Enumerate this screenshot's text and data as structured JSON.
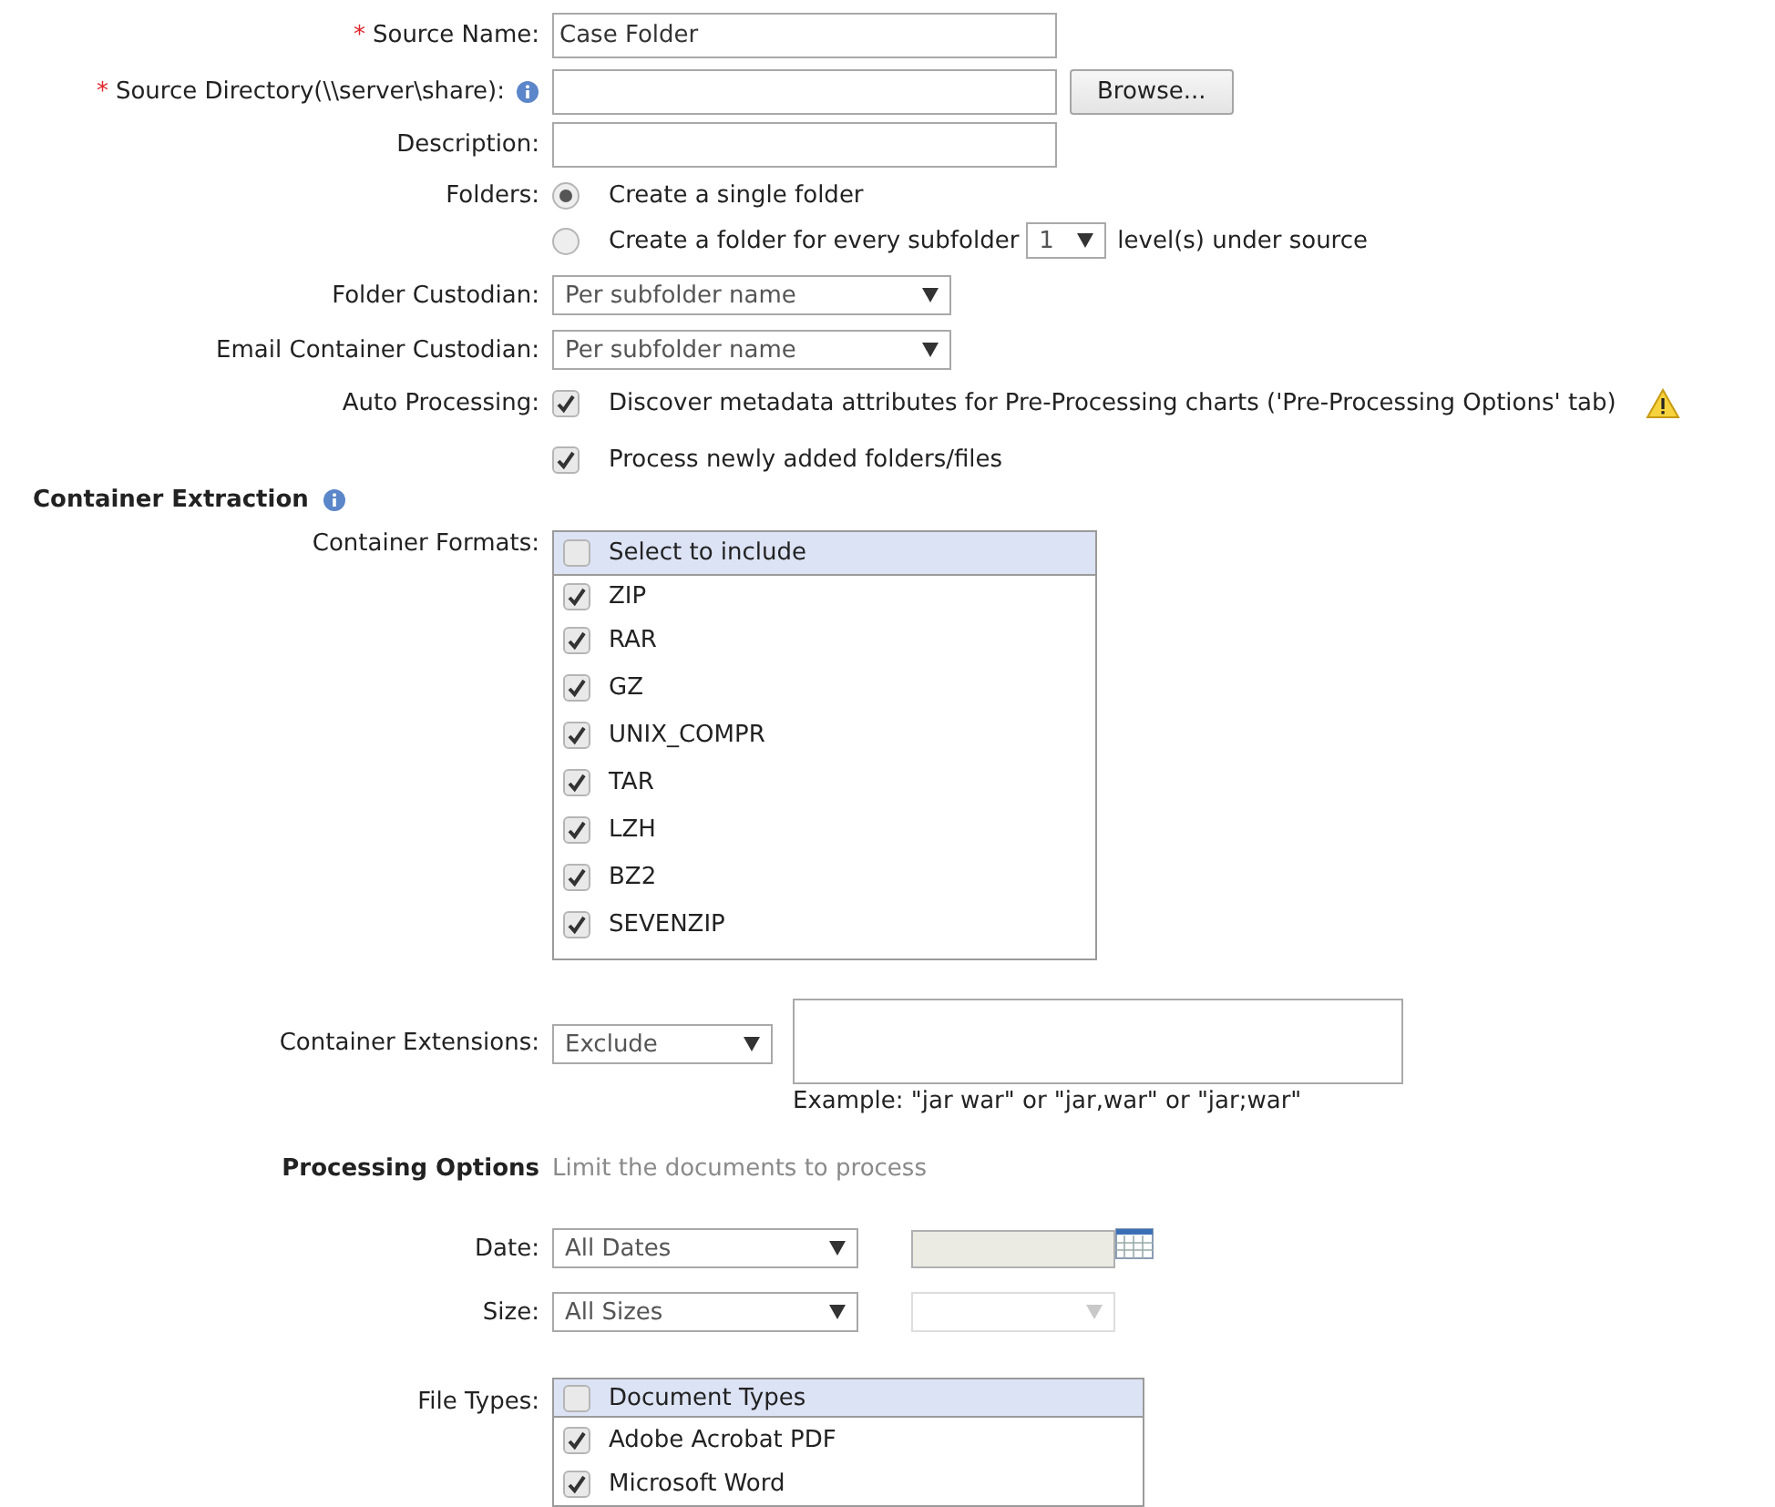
{
  "source_name": {
    "label": "Source Name:",
    "required_mark": "*",
    "value": "Case Folder"
  },
  "source_directory": {
    "label": "Source Directory(\\\\server\\share):",
    "required_mark": "*",
    "button": "Browse..."
  },
  "description": {
    "label": "Description:"
  },
  "folders": {
    "label": "Folders:",
    "options": [
      {
        "label": "Create a single folder",
        "selected": true
      },
      {
        "label": "Create a folder for every subfolder",
        "selected": false,
        "level": "1",
        "suffix": "level(s) under source"
      }
    ]
  },
  "folder_custodian": {
    "label": "Folder Custodian:",
    "value": "Per subfolder name"
  },
  "email_container_custodian": {
    "label": "Email Container Custodian:",
    "value": "Per subfolder name"
  },
  "auto_processing": {
    "label": "Auto Processing:",
    "options": [
      {
        "label": "Discover metadata attributes for Pre-Processing charts ('Pre-Processing Options' tab)",
        "checked": true,
        "warning": true
      },
      {
        "label": "Process newly added folders/files",
        "checked": true,
        "warning": false
      }
    ]
  },
  "container_extraction": {
    "title": "Container Extraction",
    "formats": {
      "label": "Container Formats:",
      "header": "Select to include",
      "header_checked": false,
      "items": [
        {
          "label": "ZIP",
          "checked": true
        },
        {
          "label": "RAR",
          "checked": true
        },
        {
          "label": "GZ",
          "checked": true
        },
        {
          "label": "UNIX_COMPR",
          "checked": true
        },
        {
          "label": "TAR",
          "checked": true
        },
        {
          "label": "LZH",
          "checked": true
        },
        {
          "label": "BZ2",
          "checked": true
        },
        {
          "label": "SEVENZIP",
          "checked": true
        }
      ]
    },
    "extensions": {
      "label": "Container Extensions:",
      "mode": "Exclude",
      "example": "Example: \"jar war\" or \"jar,war\" or \"jar;war\""
    }
  },
  "processing_options": {
    "title": "Processing Options",
    "hint": "Limit the documents to process",
    "date": {
      "label": "Date:",
      "value": "All Dates"
    },
    "size": {
      "label": "Size:",
      "value": "All Sizes"
    },
    "file_types": {
      "label": "File Types:",
      "header": "Document Types",
      "header_checked": false,
      "items": [
        {
          "label": "Adobe Acrobat PDF",
          "checked": true
        },
        {
          "label": "Microsoft Word",
          "checked": true
        }
      ]
    }
  }
}
